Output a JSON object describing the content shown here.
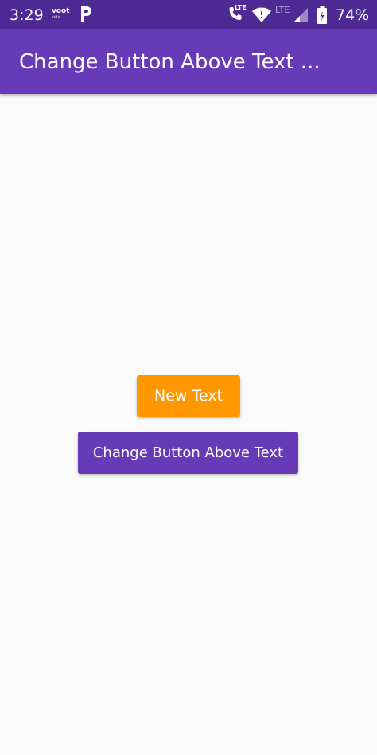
{
  "status_bar": {
    "time": "3:29",
    "notification_app": "voot",
    "notification_app_sub": "kids",
    "call_network_label": "LTE",
    "secondary_network_label": "LTE",
    "battery_percent": "74%",
    "background_color": "#4e2b94",
    "icons": [
      "voot-icon",
      "p-icon",
      "wifi-call-icon",
      "wifi-icon",
      "signal-icon",
      "battery-icon"
    ]
  },
  "app_bar": {
    "title": "Change Button Above Text ...",
    "background_color": "#673ab7"
  },
  "main": {
    "text_button": {
      "label": "New Text",
      "color": "#ff9800"
    },
    "change_button": {
      "label": "Change Button Above Text",
      "color": "#673ab7"
    },
    "background_color": "#fafafa"
  }
}
